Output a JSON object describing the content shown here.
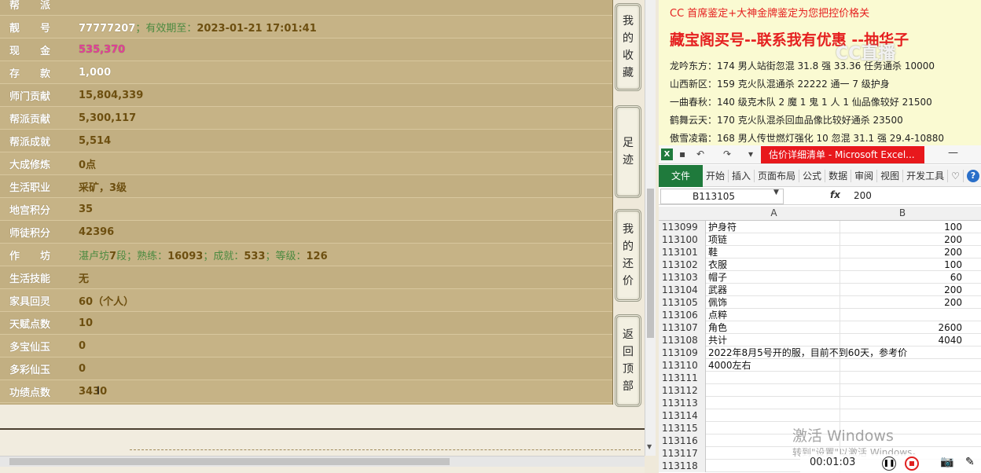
{
  "info_rows": [
    {
      "label": "帮　　派",
      "value": ""
    },
    {
      "label": "靓　　号",
      "value": "77777207",
      "extra_g": "；有效期至：",
      "extra_y": "2023-01-21 17:01:41"
    },
    {
      "label": "现　　金",
      "value": "535,370",
      "pink": true
    },
    {
      "label": "存　　款",
      "value": "1,000"
    },
    {
      "label": "师门贡献",
      "value": "15,804,339",
      "yellow": true
    },
    {
      "label": "帮派贡献",
      "value": "5,300,117",
      "yellow": true
    },
    {
      "label": "帮派成就",
      "value": "5,514",
      "yellow": true
    },
    {
      "label": "大成修炼",
      "value": "0点",
      "yellow": true
    },
    {
      "label": "生活职业",
      "value": "采矿，3级",
      "yellow": true
    },
    {
      "label": "地宫积分",
      "value": "35",
      "yellow": true
    },
    {
      "label": "师徒积分",
      "value": "42396",
      "yellow": true
    },
    {
      "label": "作　　坊",
      "value": "",
      "workshop": [
        "湛卢坊",
        "7",
        "段；熟练：",
        "16093",
        "；成就：",
        "533",
        "；等级：",
        "126"
      ]
    },
    {
      "label": "生活技能",
      "value": "无",
      "yellow": true
    },
    {
      "label": "家具回灵",
      "value": "60（个人）",
      "yellow": true
    },
    {
      "label": "天赋点数",
      "value": "10",
      "yellow": true
    },
    {
      "label": "多宝仙玉",
      "value": "0",
      "yellow": true
    },
    {
      "label": "多彩仙玉",
      "value": "0",
      "yellow": true
    },
    {
      "label": "功绩点数",
      "value": "3430",
      "yellow": true
    }
  ],
  "side_buttons": [
    {
      "name": "my-favorites",
      "chars": [
        "我",
        "的",
        "收",
        "藏"
      ]
    },
    {
      "name": "footprints",
      "chars": [
        "足",
        "迹"
      ]
    },
    {
      "name": "my-counteroffer",
      "chars": [
        "我",
        "的",
        "还",
        "价"
      ]
    },
    {
      "name": "back-to-top",
      "chars": [
        "返",
        "回",
        "顶",
        "部"
      ]
    }
  ],
  "doc": {
    "line1": "CC 首席鉴定+大神金牌鉴定为您把控价格关",
    "line2": "藏宝阁买号--联系我有优惠 --抽华子",
    "watermark": "CC直播",
    "lines": [
      "龙吟东方：174 男人站街忽混 31.8 强 33.36 任务通杀 10000",
      "山西新区：159 克火队混通杀 22222 通一 7 级护身",
      "一曲春秋：140 级克木队 2 魔 1 鬼 1 人 1 仙品像较好 21500",
      "鹤舞云天：170 克火队混杀回血品像比较好通杀 23500",
      "傲雪凌霜：168 男人传世燃灯强化 10 忽混 31.1 强 29.4-10880"
    ]
  },
  "excel": {
    "logo": "X",
    "title": "估价详细清单 - Microsoft Excel...",
    "minimize": "—",
    "ribbon_file": "文件",
    "ribbon_tabs": [
      "开始",
      "插入",
      "页面布局",
      "公式",
      "数据",
      "审阅",
      "视图",
      "开发工具"
    ],
    "help": "?",
    "name_box": "B113105",
    "fx": "fx",
    "formula_value": "200",
    "col_a": "A",
    "col_b": "B",
    "rows": [
      {
        "n": "113099",
        "a": "护身符",
        "b": "100"
      },
      {
        "n": "113100",
        "a": "项链",
        "b": "200"
      },
      {
        "n": "113101",
        "a": "鞋",
        "b": "200"
      },
      {
        "n": "113102",
        "a": "衣服",
        "b": "100"
      },
      {
        "n": "113103",
        "a": "帽子",
        "b": "60"
      },
      {
        "n": "113104",
        "a": "武器",
        "b": "200"
      },
      {
        "n": "113105",
        "a": "佩饰",
        "b": "200"
      },
      {
        "n": "113106",
        "a": "点粹",
        "b": ""
      },
      {
        "n": "113107",
        "a": "角色",
        "b": "2600"
      },
      {
        "n": "113108",
        "a": "共计",
        "b": "4040"
      },
      {
        "n": "113109",
        "a": "2022年8月5号开的服，目前不到60天，参考价",
        "b": ""
      },
      {
        "n": "113110",
        "a": "4000左右",
        "b": ""
      },
      {
        "n": "113111",
        "a": "",
        "b": ""
      },
      {
        "n": "113112",
        "a": "",
        "b": ""
      },
      {
        "n": "113113",
        "a": "",
        "b": ""
      },
      {
        "n": "113114",
        "a": "",
        "b": ""
      },
      {
        "n": "113115",
        "a": "",
        "b": ""
      },
      {
        "n": "113116",
        "a": "",
        "b": ""
      },
      {
        "n": "113117",
        "a": "",
        "b": ""
      },
      {
        "n": "113118",
        "a": "",
        "b": ""
      }
    ]
  },
  "activate": {
    "title": "激活 Windows",
    "sub": "转到\"设置\"以激活 Windows。"
  },
  "recorder": {
    "time": "00:01:03"
  }
}
